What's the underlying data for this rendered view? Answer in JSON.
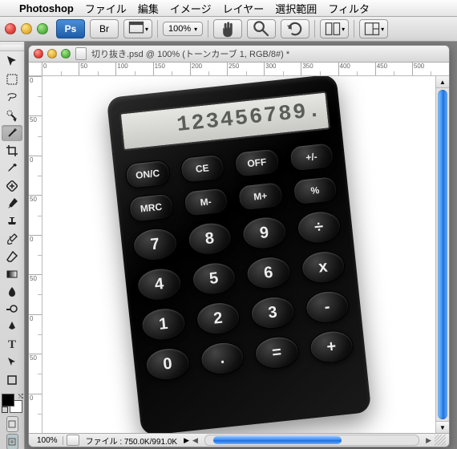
{
  "menubar": {
    "appname": "Photoshop",
    "items": [
      "ファイル",
      "編集",
      "イメージ",
      "レイヤー",
      "選択範囲",
      "フィルタ"
    ]
  },
  "optbar": {
    "ps": "Ps",
    "br": "Br",
    "zoom": "100%"
  },
  "doc": {
    "title": "切り抜き.psd @ 100% (トーンカーブ 1, RGB/8#) *",
    "ruler_h": [
      "0",
      "50",
      "100",
      "150",
      "200",
      "250",
      "300",
      "350",
      "400",
      "450",
      "500"
    ],
    "ruler_v": [
      "0",
      "50",
      "0",
      "50",
      "0",
      "50",
      "0",
      "50",
      "0"
    ],
    "zoom": "100%",
    "fileinfo": "ファイル : 750.0K/991.0K"
  },
  "calc": {
    "display": "123456789.",
    "row1": [
      "ON/C",
      "CE",
      "OFF",
      "+/-"
    ],
    "row2": [
      "MRC",
      "M-",
      "M+",
      "%"
    ],
    "row3": [
      "7",
      "8",
      "9",
      "÷"
    ],
    "row4": [
      "4",
      "5",
      "6",
      "x"
    ],
    "row5": [
      "1",
      "2",
      "3",
      "-"
    ],
    "row6": [
      "0",
      ".",
      "=",
      "+"
    ]
  }
}
